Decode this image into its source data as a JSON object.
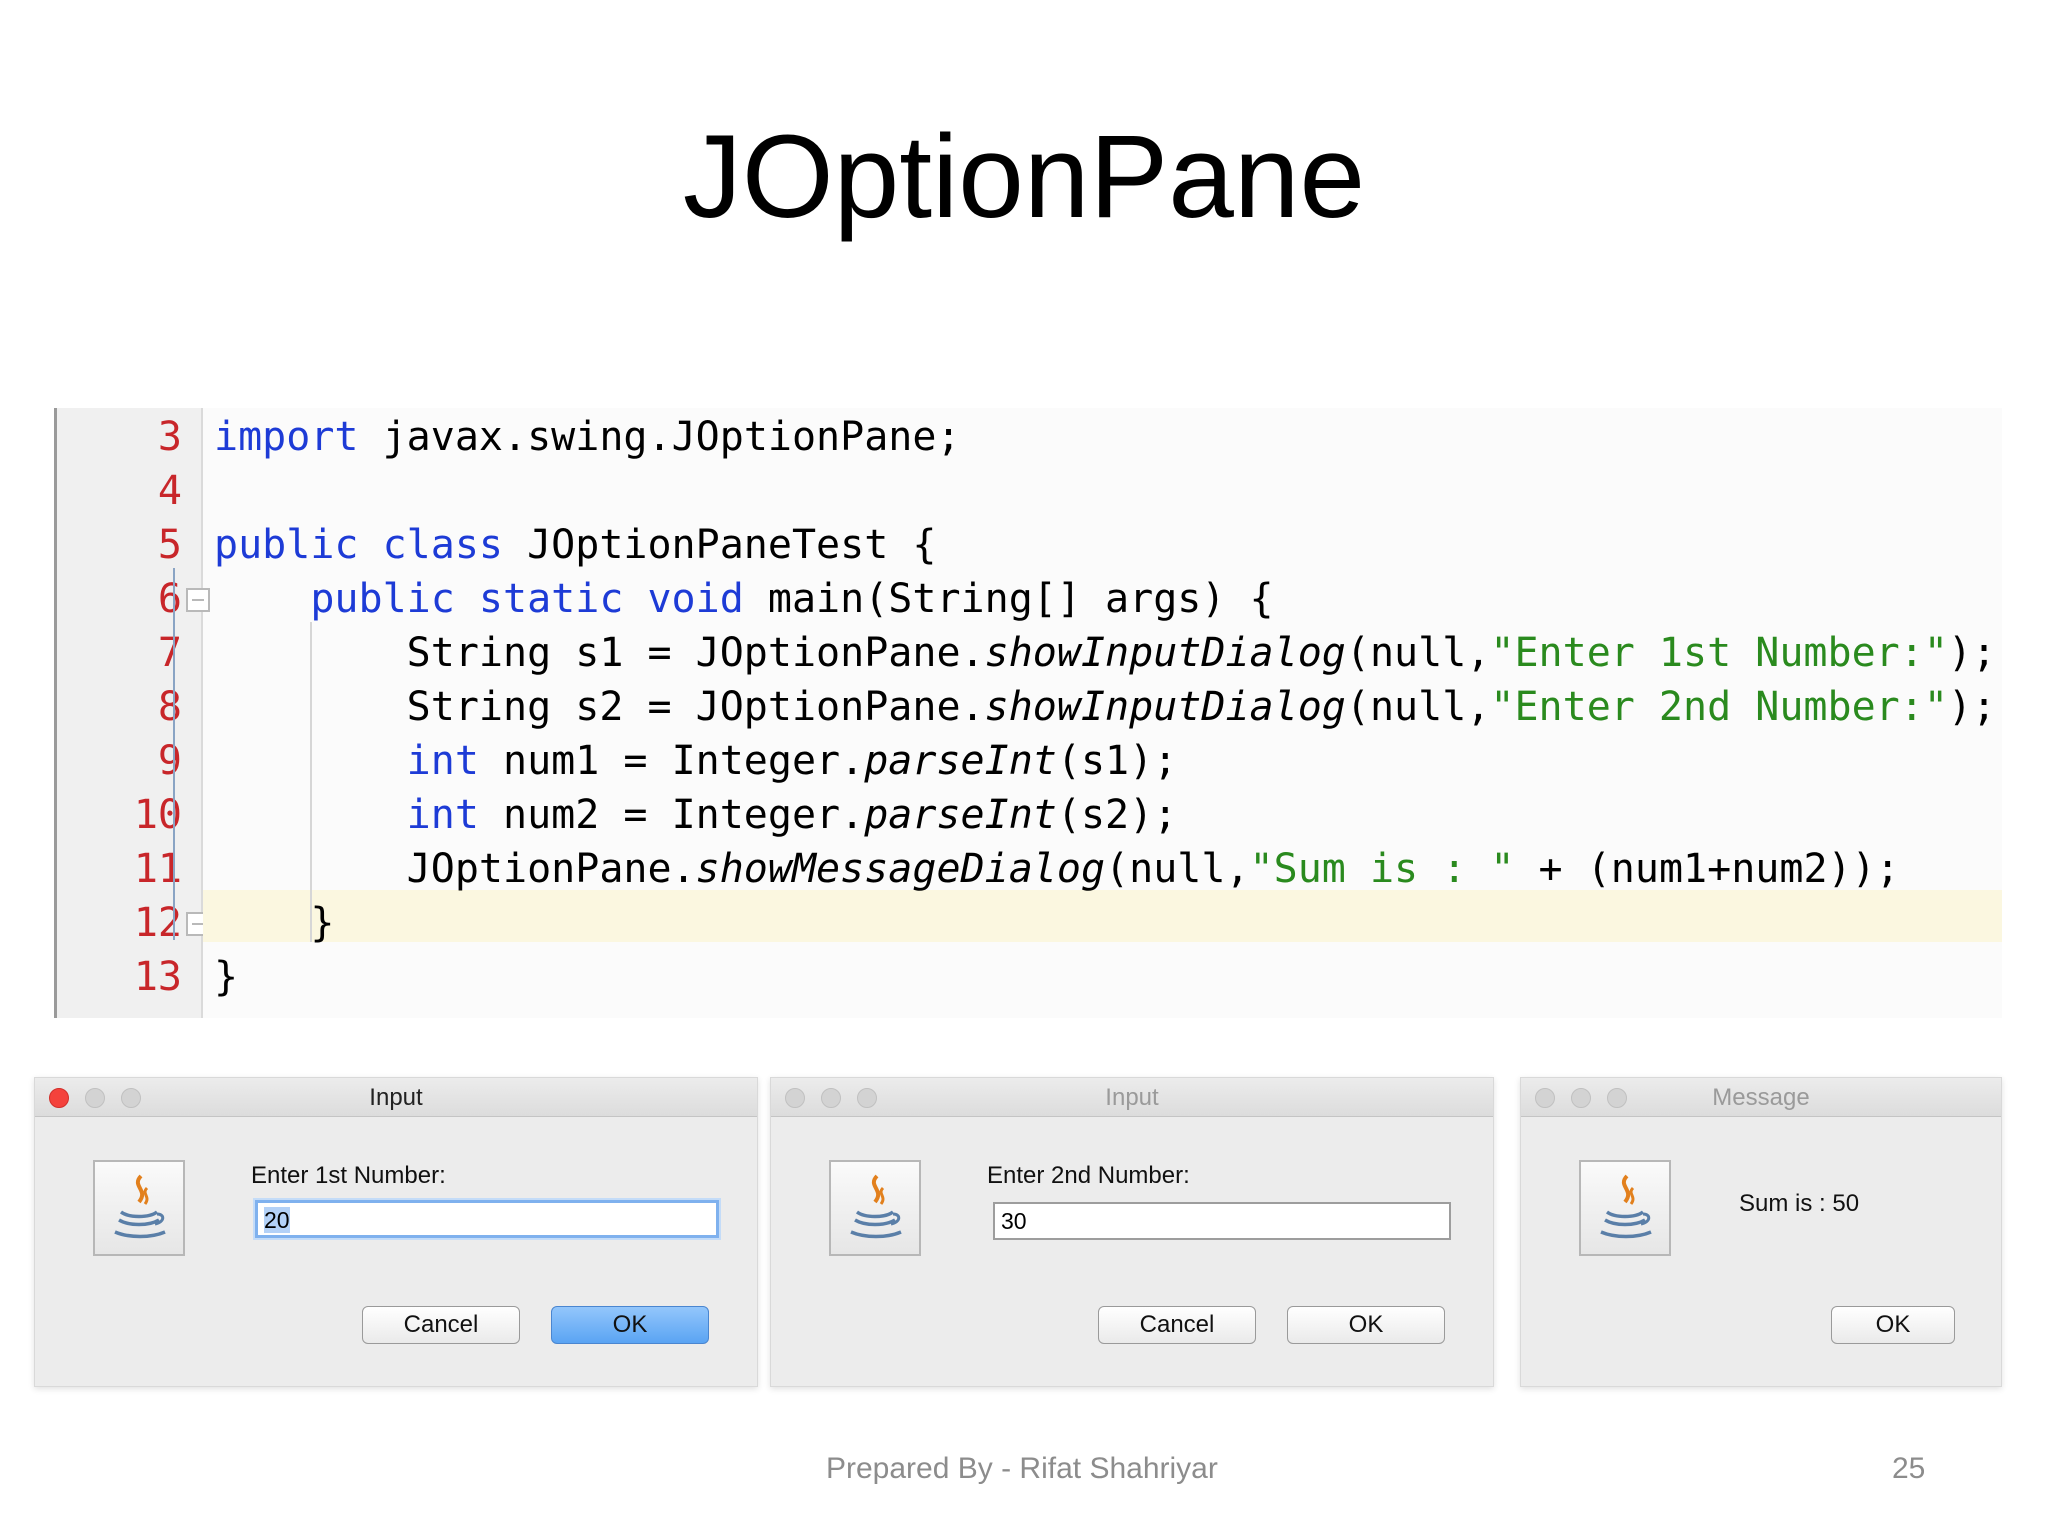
{
  "slide": {
    "title": "JOptionPane",
    "footer_text": "Prepared By - Rifat Shahriyar",
    "page_number": "25"
  },
  "editor": {
    "line_numbers": [
      "3",
      "4",
      "5",
      "6",
      "7",
      "8",
      "9",
      "10",
      "11",
      "12",
      "13"
    ],
    "lines": [
      {
        "t1": "import",
        "t2": " javax.swing.JOptionPane;"
      },
      {
        "t1": ""
      },
      {
        "t1": "public class",
        "t2": " JOptionPaneTest {"
      },
      {
        "t0": "    ",
        "t1": "public static void",
        "t2": " main(String[] args) {"
      },
      {
        "t0": "        String s1 = JOptionPane.",
        "t1": "showInputDialog",
        "t2": "(null,",
        "t3": "\"Enter 1st Number:\"",
        "t4": ");"
      },
      {
        "t0": "        String s2 = JOptionPane.",
        "t1": "showInputDialog",
        "t2": "(null,",
        "t3": "\"Enter 2nd Number:\"",
        "t4": ");"
      },
      {
        "t0": "        ",
        "t1": "int",
        "t2": " num1 = Integer.",
        "t3": "parseInt",
        "t4": "(s1);"
      },
      {
        "t0": "        ",
        "t1": "int",
        "t2": " num2 = Integer.",
        "t3": "parseInt",
        "t4": "(s2);"
      },
      {
        "t0": "        JOptionPane.",
        "t1": "showMessageDialog",
        "t2": "(null,",
        "t3": "\"Sum is : \"",
        "t4": " + (num1+num2));"
      },
      {
        "t0": "    }"
      },
      {
        "t0": "}"
      }
    ],
    "colors": {
      "keyword": "#1d3bd6",
      "string": "#2a8a1e",
      "line_number": "#c8262a",
      "current_line": "#fbf7e0"
    }
  },
  "dialogs": [
    {
      "title": "Input",
      "prompt": "Enter 1st Number:",
      "value": "20",
      "cancel": "Cancel",
      "ok": "OK",
      "icon": "java-coffee-cup-icon"
    },
    {
      "title": "Input",
      "prompt": "Enter 2nd Number:",
      "value": "30",
      "cancel": "Cancel",
      "ok": "OK",
      "icon": "java-coffee-cup-icon"
    },
    {
      "title": "Message",
      "message": "Sum is : 50",
      "ok": "OK",
      "icon": "java-coffee-cup-icon"
    }
  ]
}
